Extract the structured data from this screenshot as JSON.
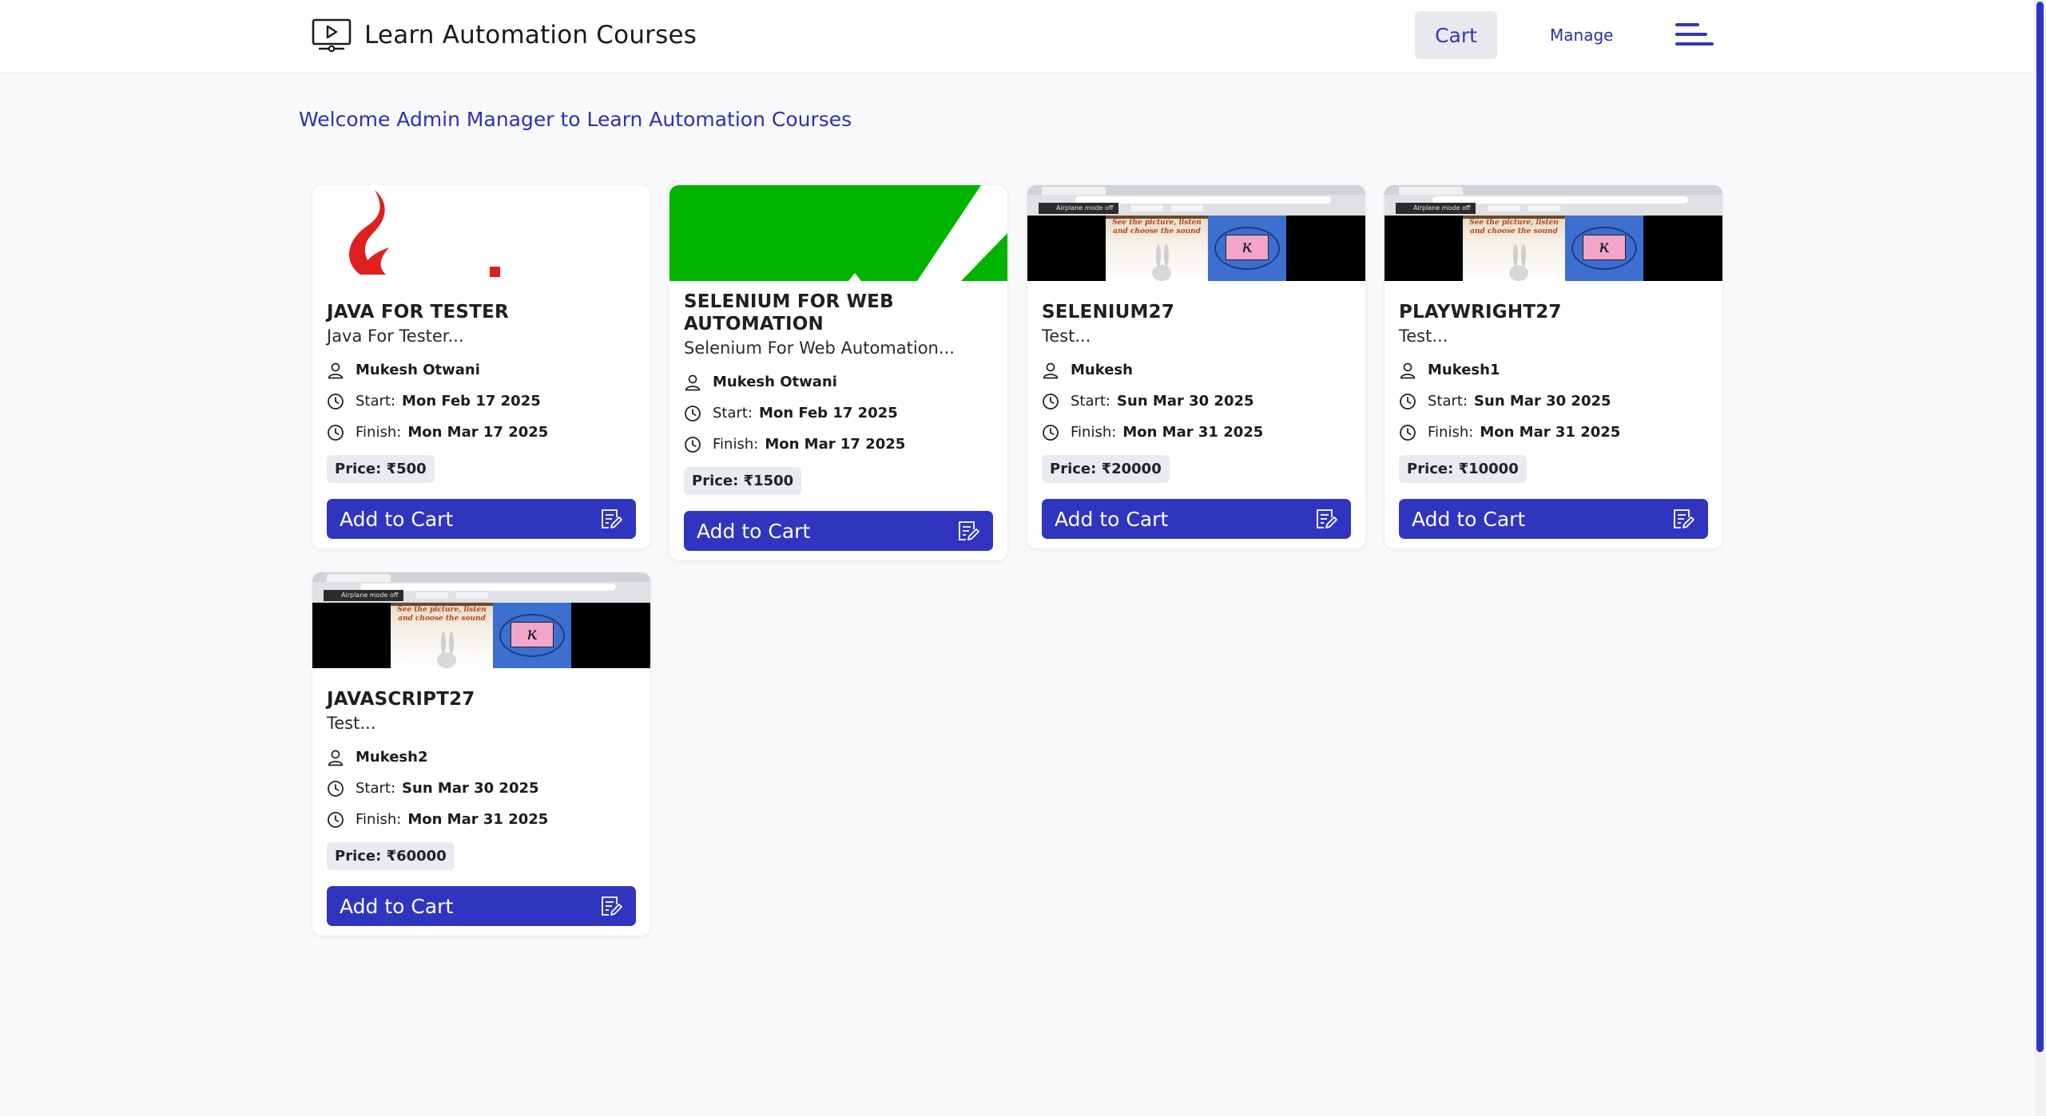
{
  "header": {
    "title": "Learn Automation Courses",
    "cart_label": "Cart",
    "manage_label": "Manage"
  },
  "welcome": "Welcome Admin Manager to Learn Automation Courses",
  "courses": [
    {
      "title": "JAVA FOR TESTER",
      "desc": "Java For Tester...",
      "instructor": "Mukesh Otwani",
      "start_label": "Start:",
      "start": "Mon Feb 17 2025",
      "finish_label": "Finish:",
      "finish": "Mon Mar 17 2025",
      "price": "Price: ₹500",
      "button": "Add to Cart"
    },
    {
      "title": "SELENIUM FOR WEB AUTOMATION",
      "desc": "Selenium For Web Automation...",
      "instructor": "Mukesh Otwani",
      "start_label": "Start:",
      "start": "Mon Feb 17 2025",
      "finish_label": "Finish:",
      "finish": "Mon Mar 17 2025",
      "price": "Price: ₹1500",
      "button": "Add to Cart"
    },
    {
      "title": "SELENIUM27",
      "desc": "Test...",
      "instructor": "Mukesh",
      "start_label": "Start:",
      "start": "Sun Mar 30 2025",
      "finish_label": "Finish:",
      "finish": "Mon Mar 31 2025",
      "price": "Price: ₹20000",
      "button": "Add to Cart"
    },
    {
      "title": "PLAYWRIGHT27",
      "desc": "Test...",
      "instructor": "Mukesh1",
      "start_label": "Start:",
      "start": "Sun Mar 30 2025",
      "finish_label": "Finish:",
      "finish": "Mon Mar 31 2025",
      "price": "Price: ₹10000",
      "button": "Add to Cart"
    },
    {
      "title": "JAVASCRIPT27",
      "desc": "Test...",
      "instructor": "Mukesh2",
      "start_label": "Start:",
      "start": "Sun Mar 30 2025",
      "finish_label": "Finish:",
      "finish": "Mon Mar 31 2025",
      "price": "Price: ₹60000",
      "button": "Add to Cart"
    }
  ],
  "thumb_text": {
    "airplane": "Airplane mode off",
    "poster": "See the picture, listen and choose the sound",
    "glyph": "ĸ"
  },
  "colors": {
    "accent": "#3035c0",
    "welcome": "#2d30b6",
    "selenium_green": "#00b400",
    "java_red": "#e0201f"
  },
  "icons": {
    "brand": "monitor-play-icon",
    "menu": "hamburger-menu-icon",
    "instructor": "user-icon",
    "time": "clock-icon",
    "cart": "edit-note-icon"
  }
}
